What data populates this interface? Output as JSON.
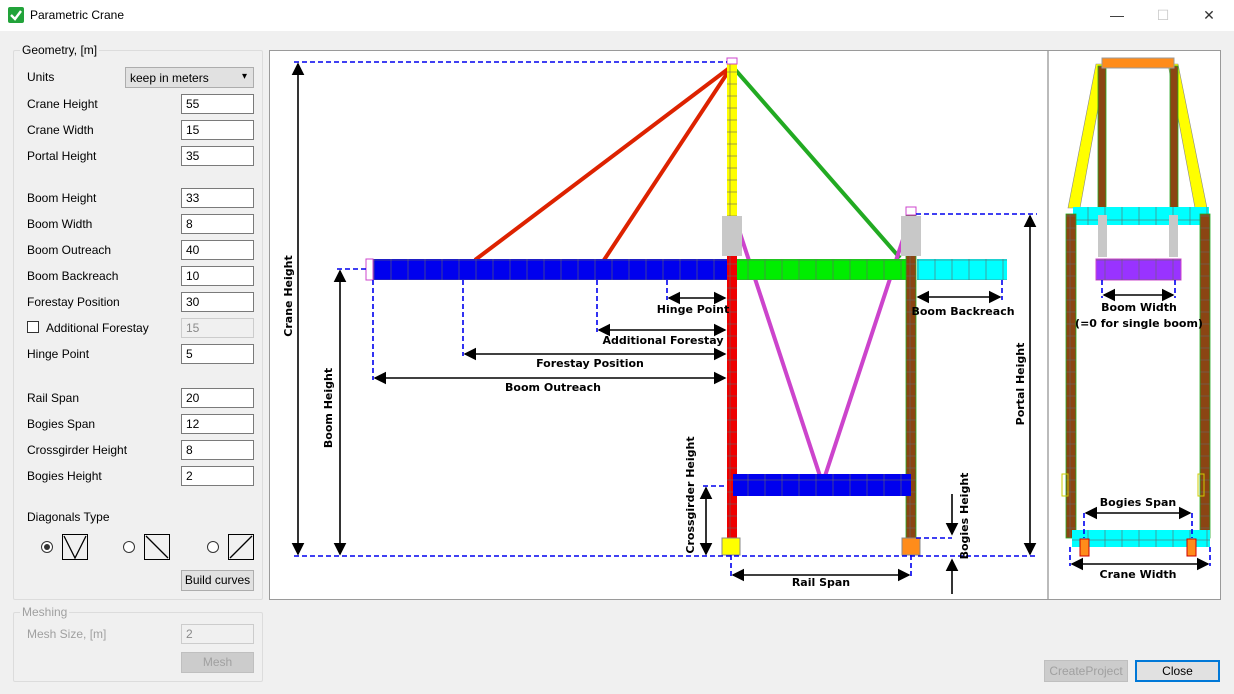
{
  "window": {
    "title": "Parametric Crane",
    "minimize": "—",
    "maximize": "☐",
    "close": "✕"
  },
  "geometry": {
    "legend": "Geometry, [m]",
    "units_label": "Units",
    "units_value": "keep in meters",
    "crane_height_label": "Crane Height",
    "crane_height": "55",
    "crane_width_label": "Crane Width",
    "crane_width": "15",
    "portal_height_label": "Portal Height",
    "portal_height": "35",
    "boom_height_label": "Boom Height",
    "boom_height": "33",
    "boom_width_label": "Boom Width",
    "boom_width": "8",
    "boom_outreach_label": "Boom Outreach",
    "boom_outreach": "40",
    "boom_backreach_label": "Boom Backreach",
    "boom_backreach": "10",
    "forestay_position_label": "Forestay Position",
    "forestay_position": "30",
    "additional_forestay_label": "Additional Forestay",
    "additional_forestay": "15",
    "hinge_point_label": "Hinge Point",
    "hinge_point": "5",
    "rail_span_label": "Rail Span",
    "rail_span": "20",
    "bogies_span_label": "Bogies Span",
    "bogies_span": "12",
    "crossgirder_height_label": "Crossgirder Height",
    "crossgirder_height": "8",
    "bogies_height_label": "Bogies Height",
    "bogies_height": "2",
    "diagonals_type_label": "Diagonals Type",
    "build_curves_label": "Build curves"
  },
  "meshing": {
    "legend": "Meshing",
    "mesh_size_label": "Mesh Size, [m]",
    "mesh_size": "2",
    "mesh_button": "Mesh"
  },
  "footer": {
    "create_project": "CreateProject",
    "close": "Close"
  },
  "diagram": {
    "crane_height": "Crane Height",
    "boom_height": "Boom Height",
    "hinge_point": "Hinge Point",
    "additional_forestay": "Additional Forestay",
    "forestay_position": "Forestay Position",
    "boom_outreach": "Boom Outreach",
    "boom_backreach": "Boom Backreach",
    "portal_height": "Portal Height",
    "crossgirder_height": "Crossgirder Height",
    "bogies_height": "Bogies Height",
    "rail_span": "Rail Span",
    "boom_width": "Boom Width",
    "boom_width_note": "(=0 for single boom)",
    "bogies_span": "Bogies Span",
    "crane_width": "Crane Width"
  },
  "colors": {
    "accent": "#0078d7",
    "boom": "#0000ee",
    "boom_mid": "#00ee00",
    "backreach": "#00ffff",
    "tower": "#ffff00",
    "leg": "#ee0000",
    "brace": "#cc44cc",
    "portal_leg": "#8b4513"
  }
}
